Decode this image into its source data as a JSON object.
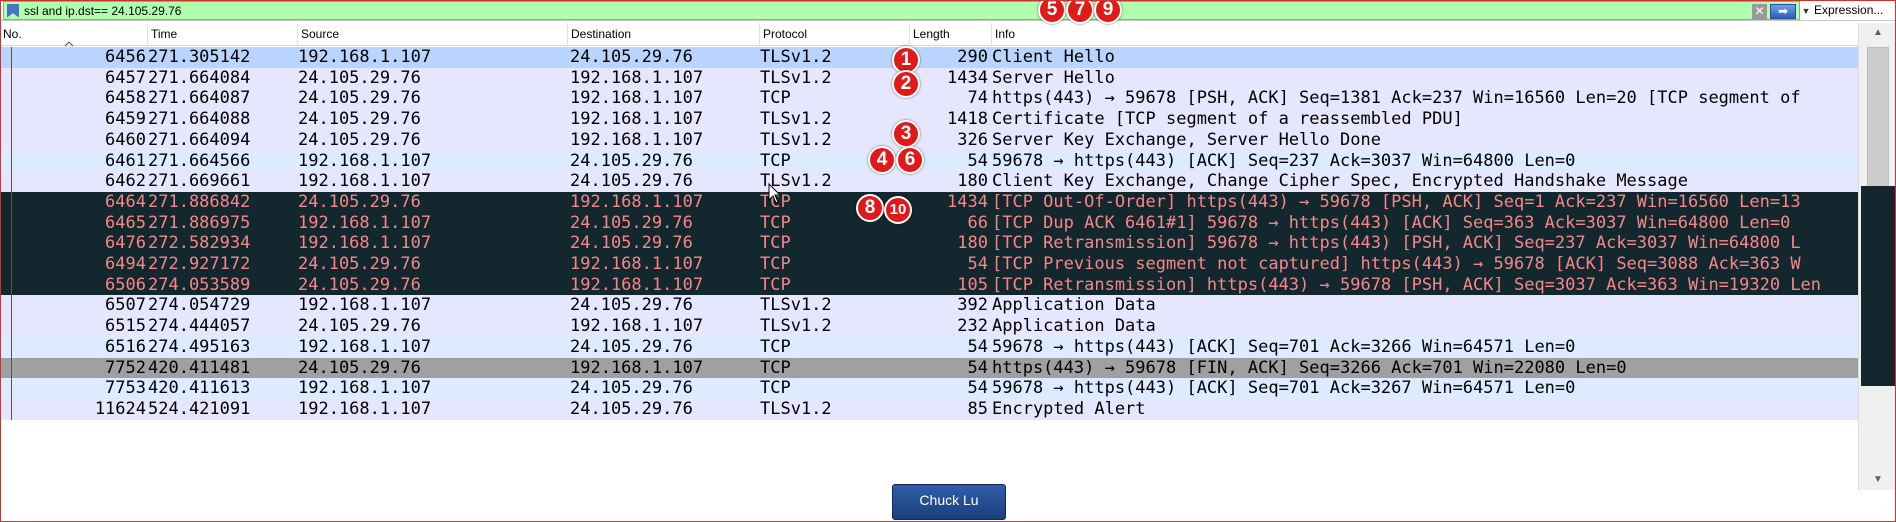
{
  "filter": {
    "text": "ssl and ip.dst== 24.105.29.76",
    "clear_glyph": "✕",
    "apply_glyph": "➡",
    "dropdown_glyph": "▼",
    "expression_label": "Expression..."
  },
  "columns": {
    "no": "No.",
    "time": "Time",
    "source": "Source",
    "destination": "Destination",
    "protocol": "Protocol",
    "length": "Length",
    "info": "Info"
  },
  "colors": {
    "selected_bg": "#b9d4ff",
    "light_bg": "#e7e6ff",
    "tcp_light_bg": "#e7e6ff",
    "tcp_row_bg": "#dcebff",
    "bad_bg": "#12272e",
    "bad_fg": "#f78787",
    "fin_bg": "#a0a0a0",
    "badge": "#e01919"
  },
  "packets": [
    {
      "no": "6456",
      "time": "271.305142",
      "source": "192.168.1.107",
      "destination": "24.105.29.76",
      "protocol": "TLSv1.2",
      "length": "290",
      "info": "Client Hello",
      "style": "selected"
    },
    {
      "no": "6457",
      "time": "271.664084",
      "source": "24.105.29.76",
      "destination": "192.168.1.107",
      "protocol": "TLSv1.2",
      "length": "1434",
      "info": "Server Hello",
      "style": "light"
    },
    {
      "no": "6458",
      "time": "271.664087",
      "source": "24.105.29.76",
      "destination": "192.168.1.107",
      "protocol": "TCP",
      "length": "74",
      "info": "https(443) → 59678 [PSH, ACK] Seq=1381 Ack=237 Win=16560 Len=20 [TCP segment of",
      "style": "light"
    },
    {
      "no": "6459",
      "time": "271.664088",
      "source": "24.105.29.76",
      "destination": "192.168.1.107",
      "protocol": "TLSv1.2",
      "length": "1418",
      "info": "Certificate [TCP segment of a reassembled PDU]",
      "style": "light"
    },
    {
      "no": "6460",
      "time": "271.664094",
      "source": "24.105.29.76",
      "destination": "192.168.1.107",
      "protocol": "TLSv1.2",
      "length": "326",
      "info": "Server Key Exchange, Server Hello Done",
      "style": "light"
    },
    {
      "no": "6461",
      "time": "271.664566",
      "source": "192.168.1.107",
      "destination": "24.105.29.76",
      "protocol": "TCP",
      "length": "54",
      "info": "59678 → https(443) [ACK] Seq=237 Ack=3037 Win=64800 Len=0",
      "style": "tcp"
    },
    {
      "no": "6462",
      "time": "271.669661",
      "source": "192.168.1.107",
      "destination": "24.105.29.76",
      "protocol": "TLSv1.2",
      "length": "180",
      "info": "Client Key Exchange, Change Cipher Spec, Encrypted Handshake Message",
      "style": "light"
    },
    {
      "no": "6464",
      "time": "271.886842",
      "source": "24.105.29.76",
      "destination": "192.168.1.107",
      "protocol": "TCP",
      "length": "1434",
      "info": "[TCP Out-Of-Order] https(443) → 59678 [PSH, ACK] Seq=1 Ack=237 Win=16560 Len=13",
      "style": "bad"
    },
    {
      "no": "6465",
      "time": "271.886975",
      "source": "192.168.1.107",
      "destination": "24.105.29.76",
      "protocol": "TCP",
      "length": "66",
      "info": "[TCP Dup ACK 6461#1] 59678 → https(443) [ACK] Seq=363 Ack=3037 Win=64800 Len=0",
      "style": "bad"
    },
    {
      "no": "6476",
      "time": "272.582934",
      "source": "192.168.1.107",
      "destination": "24.105.29.76",
      "protocol": "TCP",
      "length": "180",
      "info": "[TCP Retransmission] 59678 → https(443) [PSH, ACK] Seq=237 Ack=3037 Win=64800 L",
      "style": "bad"
    },
    {
      "no": "6494",
      "time": "272.927172",
      "source": "24.105.29.76",
      "destination": "192.168.1.107",
      "protocol": "TCP",
      "length": "54",
      "info": "[TCP Previous segment not captured] https(443) → 59678 [ACK] Seq=3088 Ack=363 W",
      "style": "bad"
    },
    {
      "no": "6506",
      "time": "274.053589",
      "source": "24.105.29.76",
      "destination": "192.168.1.107",
      "protocol": "TCP",
      "length": "105",
      "info": "[TCP Retransmission] https(443) → 59678 [PSH, ACK] Seq=3037 Ack=363 Win=19320 Len",
      "style": "bad"
    },
    {
      "no": "6507",
      "time": "274.054729",
      "source": "192.168.1.107",
      "destination": "24.105.29.76",
      "protocol": "TLSv1.2",
      "length": "392",
      "info": "Application Data",
      "style": "light"
    },
    {
      "no": "6515",
      "time": "274.444057",
      "source": "24.105.29.76",
      "destination": "192.168.1.107",
      "protocol": "TLSv1.2",
      "length": "232",
      "info": "Application Data",
      "style": "light"
    },
    {
      "no": "6516",
      "time": "274.495163",
      "source": "192.168.1.107",
      "destination": "24.105.29.76",
      "protocol": "TCP",
      "length": "54",
      "info": "59678 → https(443) [ACK] Seq=701 Ack=3266 Win=64571 Len=0",
      "style": "tcp"
    },
    {
      "no": "7752",
      "time": "420.411481",
      "source": "24.105.29.76",
      "destination": "192.168.1.107",
      "protocol": "TCP",
      "length": "54",
      "info": "https(443) → 59678 [FIN, ACK] Seq=3266 Ack=701 Win=22080 Len=0",
      "style": "fin"
    },
    {
      "no": "7753",
      "time": "420.411613",
      "source": "192.168.1.107",
      "destination": "24.105.29.76",
      "protocol": "TCP",
      "length": "54",
      "info": "59678 → https(443) [ACK] Seq=701 Ack=3267 Win=64571 Len=0",
      "style": "tcp"
    },
    {
      "no": "11624",
      "time": "524.421091",
      "source": "192.168.1.107",
      "destination": "24.105.29.76",
      "protocol": "TLSv1.2",
      "length": "85",
      "info": "Encrypted Alert",
      "style": "light"
    }
  ],
  "annotations": [
    "1",
    "2",
    "3",
    "4",
    "5",
    "6",
    "7",
    "8",
    "9",
    "10"
  ],
  "overlay_tag": "Chuck Lu",
  "scrollbar": {
    "up_glyph": "▲",
    "down_glyph": "▼"
  }
}
